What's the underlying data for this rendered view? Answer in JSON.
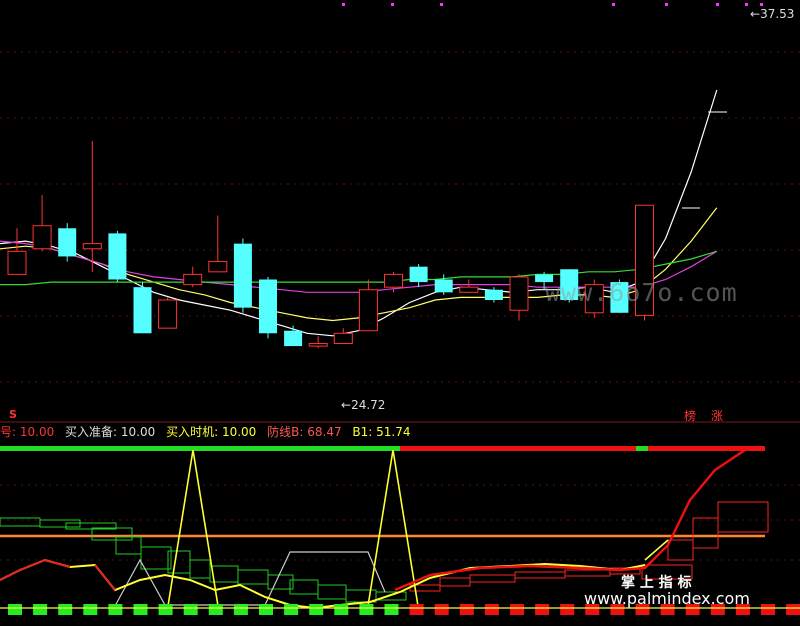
{
  "chart_data": [
    {
      "type": "candlestick",
      "title": "",
      "price_high_label": "37.53",
      "price_low_label": "24.72",
      "ylim": [
        22.5,
        38
      ],
      "candles": [
        {
          "o": 28.5,
          "c": 27.6,
          "h": 29.4,
          "l": 27.6,
          "up": true
        },
        {
          "o": 28.6,
          "c": 29.5,
          "h": 30.7,
          "l": 28.5,
          "up": true
        },
        {
          "o": 29.4,
          "c": 28.3,
          "h": 29.6,
          "l": 28.1,
          "up": false
        },
        {
          "o": 28.6,
          "c": 28.8,
          "h": 32.8,
          "l": 27.7,
          "up": true
        },
        {
          "o": 29.2,
          "c": 27.4,
          "h": 29.3,
          "l": 27.3,
          "up": false
        },
        {
          "o": 27.1,
          "c": 25.3,
          "h": 27.3,
          "l": 25.3,
          "up": false
        },
        {
          "o": 25.5,
          "c": 26.6,
          "h": 26.7,
          "l": 25.5,
          "up": true
        },
        {
          "o": 27.2,
          "c": 27.6,
          "h": 27.9,
          "l": 27.1,
          "up": true
        },
        {
          "o": 27.7,
          "c": 28.1,
          "h": 29.9,
          "l": 27.7,
          "up": true
        },
        {
          "o": 28.8,
          "c": 26.3,
          "h": 29.0,
          "l": 26.1,
          "up": false
        },
        {
          "o": 27.4,
          "c": 25.3,
          "h": 27.5,
          "l": 25.1,
          "up": false
        },
        {
          "o": 25.4,
          "c": 24.8,
          "h": 25.6,
          "l": 24.8,
          "up": false
        },
        {
          "o": 24.8,
          "c": 24.9,
          "h": 25.2,
          "l": 24.72,
          "up": true
        },
        {
          "o": 24.9,
          "c": 25.3,
          "h": 25.5,
          "l": 24.9,
          "up": true
        },
        {
          "o": 25.4,
          "c": 27.0,
          "h": 27.4,
          "l": 25.4,
          "up": true
        },
        {
          "o": 27.1,
          "c": 27.6,
          "h": 27.7,
          "l": 26.9,
          "up": true
        },
        {
          "o": 27.9,
          "c": 27.3,
          "h": 28.0,
          "l": 27.1,
          "up": false
        },
        {
          "o": 27.4,
          "c": 26.9,
          "h": 27.6,
          "l": 26.8,
          "up": false
        },
        {
          "o": 26.9,
          "c": 27.1,
          "h": 27.4,
          "l": 26.9,
          "up": true
        },
        {
          "o": 27.0,
          "c": 26.6,
          "h": 27.1,
          "l": 26.5,
          "up": false
        },
        {
          "o": 26.2,
          "c": 27.5,
          "h": 27.6,
          "l": 25.8,
          "up": true
        },
        {
          "o": 27.6,
          "c": 27.3,
          "h": 27.7,
          "l": 27.0,
          "up": false
        },
        {
          "o": 27.8,
          "c": 26.6,
          "h": 27.8,
          "l": 26.5,
          "up": false
        },
        {
          "o": 26.1,
          "c": 27.2,
          "h": 27.4,
          "l": 25.9,
          "up": true
        },
        {
          "o": 27.3,
          "c": 26.1,
          "h": 27.4,
          "l": 26.1,
          "up": false
        },
        {
          "o": 26.0,
          "c": 30.3,
          "h": 30.3,
          "l": 25.8,
          "up": true
        }
      ],
      "ma_lines": [
        {
          "color": "#ffffff",
          "values": [
            28.8,
            28.9,
            28.7,
            28.4,
            27.9,
            27.4,
            26.9,
            26.6,
            26.4,
            26.2,
            25.9,
            25.6,
            25.3,
            25.2,
            25.4,
            25.9,
            26.5,
            26.9,
            27.1,
            27.0,
            26.9,
            27.0,
            27.0,
            27.1,
            26.9,
            27.3,
            29.0,
            31.6,
            34.8
          ]
        },
        {
          "color": "#ffff66",
          "values": [
            28.6,
            28.7,
            28.6,
            28.3,
            28.0,
            27.6,
            27.3,
            27.0,
            26.8,
            26.5,
            26.3,
            26.1,
            25.9,
            25.8,
            25.9,
            26.1,
            26.3,
            26.6,
            26.7,
            26.7,
            26.7,
            26.7,
            26.8,
            26.8,
            26.7,
            27.0,
            27.8,
            28.9,
            30.2
          ]
        },
        {
          "color": "#e040e0",
          "values": [
            28.9,
            28.8,
            28.6,
            28.3,
            28.0,
            27.7,
            27.5,
            27.4,
            27.3,
            27.2,
            27.1,
            27.0,
            26.9,
            26.9,
            26.9,
            27.0,
            27.1,
            27.2,
            27.2,
            27.2,
            27.2,
            27.1,
            27.1,
            27.1,
            27.1,
            27.1,
            27.4,
            27.9,
            28.5
          ]
        },
        {
          "color": "#33dd33",
          "values": [
            27.2,
            27.2,
            27.3,
            27.3,
            27.3,
            27.3,
            27.3,
            27.3,
            27.3,
            27.3,
            27.3,
            27.3,
            27.3,
            27.3,
            27.3,
            27.3,
            27.4,
            27.4,
            27.5,
            27.5,
            27.5,
            27.6,
            27.6,
            27.7,
            27.7,
            27.8,
            28.0,
            28.2,
            28.5
          ]
        }
      ],
      "magenta_markers": 8,
      "badges": [
        "榜",
        "涨"
      ],
      "marker_s": "S"
    },
    {
      "type": "indicator",
      "legend": [
        {
          "text": "号: 10.00",
          "color": "#ff3333"
        },
        {
          "text": "买入准备: 10.00",
          "color": "#dddddd"
        },
        {
          "text": "买入时机: 10.00",
          "color": "#ffff33"
        },
        {
          "text": "防线B: 68.47",
          "color": "#ff5555"
        },
        {
          "text": "B1: 51.74",
          "color": "#ffff33"
        }
      ],
      "ylim": [
        0,
        100
      ],
      "bottom_markers": [
        "g",
        "g",
        "g",
        "g",
        "g",
        "g",
        "g",
        "g",
        "g",
        "g",
        "g",
        "g",
        "g",
        "g",
        "g",
        "g",
        "r",
        "r",
        "r",
        "r",
        "r",
        "r",
        "r",
        "r",
        "r",
        "r",
        "r",
        "r",
        "r",
        "r",
        "r",
        "r"
      ],
      "defense_line_level": 50,
      "top_bar_split_fraction": 0.55
    }
  ],
  "watermarks": {
    "url_top": "www.6o7o.com",
    "brand": "掌 上 指 标",
    "url_bottom": "www.palmindex.com"
  }
}
